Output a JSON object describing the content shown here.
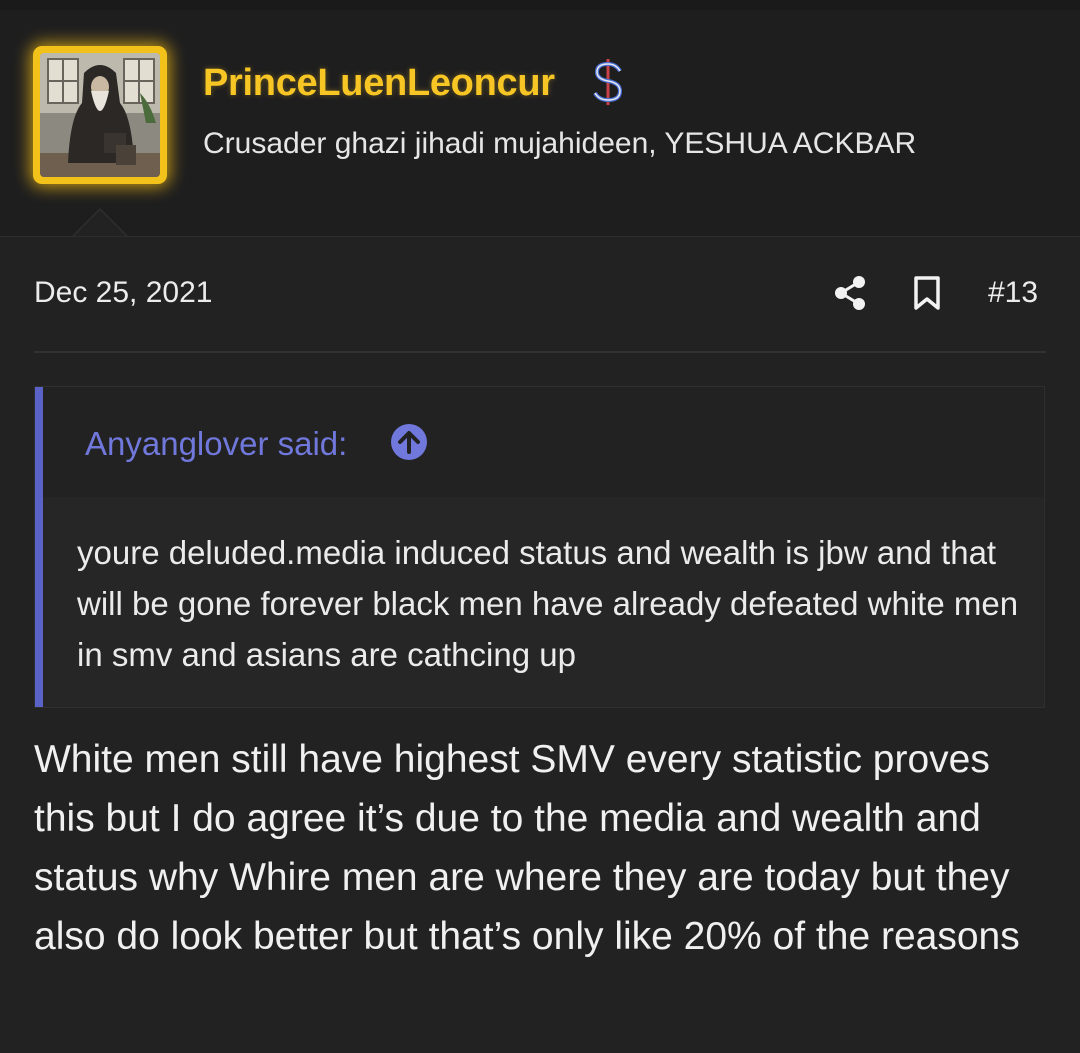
{
  "user": {
    "name": "PrinceLuenLeoncur",
    "title": "Crusader ghazi jihadi mujahideen, YESHUA ACKBAR",
    "name_color": "#f8c624",
    "badge_icon": "dollar-icon"
  },
  "post": {
    "date": "Dec 25, 2021",
    "number": "#13",
    "body": "White men still have highest SMV every statistic proves this but I do agree it’s due to the media and wealth and status why Whire men are where they are today but they also do look better but that’s only like 20% of the reasons"
  },
  "quote": {
    "attribution": "Anyanglover said:",
    "attribution_color": "#7178db",
    "text": "youre deluded.media induced status and wealth is jbw and that will be gone forever black men have already defeated white men in smv and asians are cathcing up",
    "icon": "arrow-up-circle-icon"
  },
  "actions": {
    "share_icon": "share-icon",
    "bookmark_icon": "bookmark-icon"
  }
}
